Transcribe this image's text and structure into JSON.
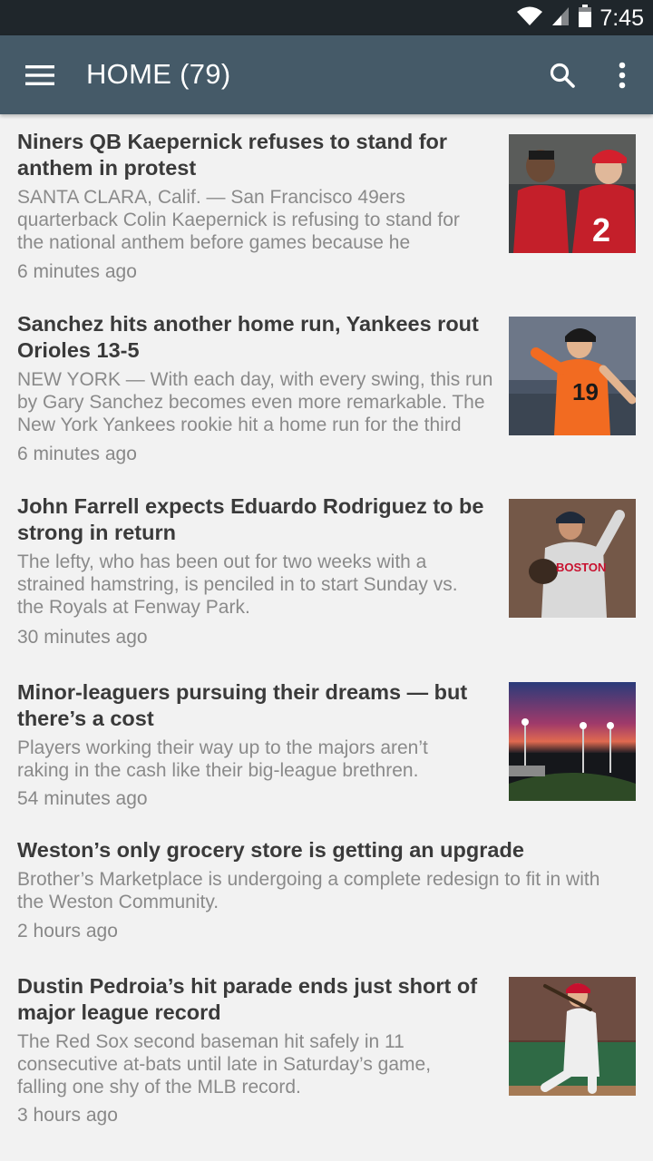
{
  "status_bar": {
    "time": "7:45",
    "icons": [
      "wifi-icon",
      "signal-icon",
      "battery-icon"
    ]
  },
  "app_bar": {
    "title": "HOME (79)",
    "icons": [
      "menu-icon",
      "search-icon",
      "more-vert-icon"
    ]
  },
  "articles": [
    {
      "headline_1": "Niners QB Kaepernick refuses to stand for",
      "headline_2": "anthem in protest",
      "summary_1": "SANTA CLARA, Calif. — San Francisco 49ers",
      "summary_2": "quarterback Colin Kaepernick is refusing to stand for",
      "summary_3": "the national anthem before games because he",
      "time": "6 minutes ago",
      "thumbnail": "football-players-photo"
    },
    {
      "headline_1": "Sanchez hits another home run, Yankees rout",
      "headline_2": "Orioles 13-5",
      "summary_1": "NEW YORK — With each day, with every swing, this run",
      "summary_2": "by Gary Sanchez becomes even more remarkable. The",
      "summary_3": "New York Yankees rookie hit a home run for the third",
      "time": "6 minutes ago",
      "thumbnail": "baseball-batter-photo"
    },
    {
      "headline_1": "John Farrell expects Eduardo Rodriguez to be",
      "headline_2": "strong in return",
      "summary_1": "The lefty, who has been out for two weeks with a",
      "summary_2": "strained hamstring, is penciled in to start Sunday vs.",
      "summary_3": "the Royals at Fenway Park.",
      "time": "30 minutes ago",
      "thumbnail": "baseball-pitcher-photo"
    },
    {
      "headline_1": "Minor-leaguers pursuing their dreams — but",
      "headline_2": "there’s a cost",
      "summary_1": "Players working their way up to the majors aren’t",
      "summary_2": "raking in the cash like their big-league brethren.",
      "summary_3": "",
      "time": "54 minutes ago",
      "thumbnail": "ballpark-at-dusk-photo"
    },
    {
      "headline_1": "Weston’s only grocery store is getting an upgrade",
      "headline_2": "",
      "summary_1": "Brother’s Marketplace is undergoing a complete redesign to fit in with",
      "summary_2": "the Weston Community.",
      "summary_3": "",
      "time": "2 hours ago",
      "thumbnail": ""
    },
    {
      "headline_1": "Dustin Pedroia’s hit parade ends just short of",
      "headline_2": "major league record",
      "summary_1": "The Red Sox second baseman hit safely in 11",
      "summary_2": "consecutive at-bats until late in Saturday’s game,",
      "summary_3": "falling one shy of the MLB record.",
      "time": "3 hours ago",
      "thumbnail": "baseball-swing-photo"
    }
  ],
  "colors": {
    "status_bar": "#1f262b",
    "app_bar": "#455a68",
    "background": "#f2f2f2",
    "headline": "#3a3a3a",
    "summary": "#8a8a8a"
  }
}
